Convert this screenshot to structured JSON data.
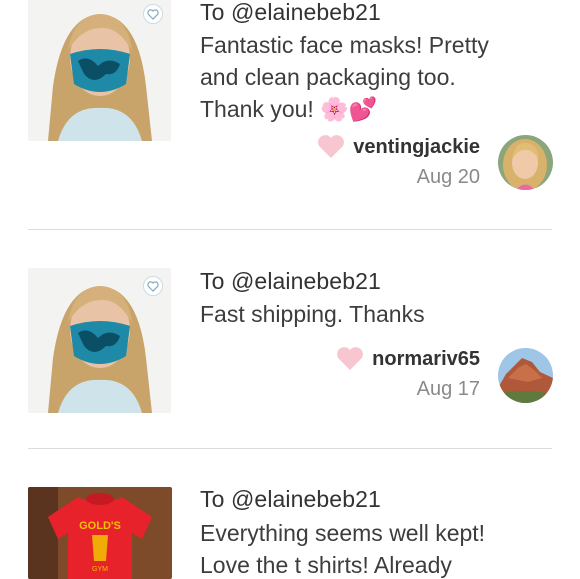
{
  "reviews": [
    {
      "to": "To @elainebeb21",
      "message_lines": [
        "Fantastic face masks! Pretty",
        "and clean packaging too.",
        "Thank you! 🌸💕"
      ],
      "username": "ventingjackie",
      "date": "Aug 20",
      "thumb": "woman-face-mask-photo",
      "avatar": "blonde-woman-avatar"
    },
    {
      "to": "To @elainebeb21",
      "message_lines": [
        "Fast shipping. Thanks"
      ],
      "username": "normariv65",
      "date": "Aug 17",
      "thumb": "woman-face-mask-photo",
      "avatar": "red-rock-mountain-avatar"
    },
    {
      "to": "To @elainebeb21",
      "message_lines": [
        "Everything seems well kept!",
        "Love the t shirts! Already"
      ],
      "thumb": "red-gold-gym-tshirt-photo"
    }
  ],
  "colors": {
    "heart": "#f7c6d0",
    "badge_border": "#c9dbe6",
    "divider": "#dcdcdc",
    "date": "#8a8a8a"
  },
  "icons": {
    "like": "heart-icon",
    "thumb_badge": "heart-outline-icon"
  }
}
